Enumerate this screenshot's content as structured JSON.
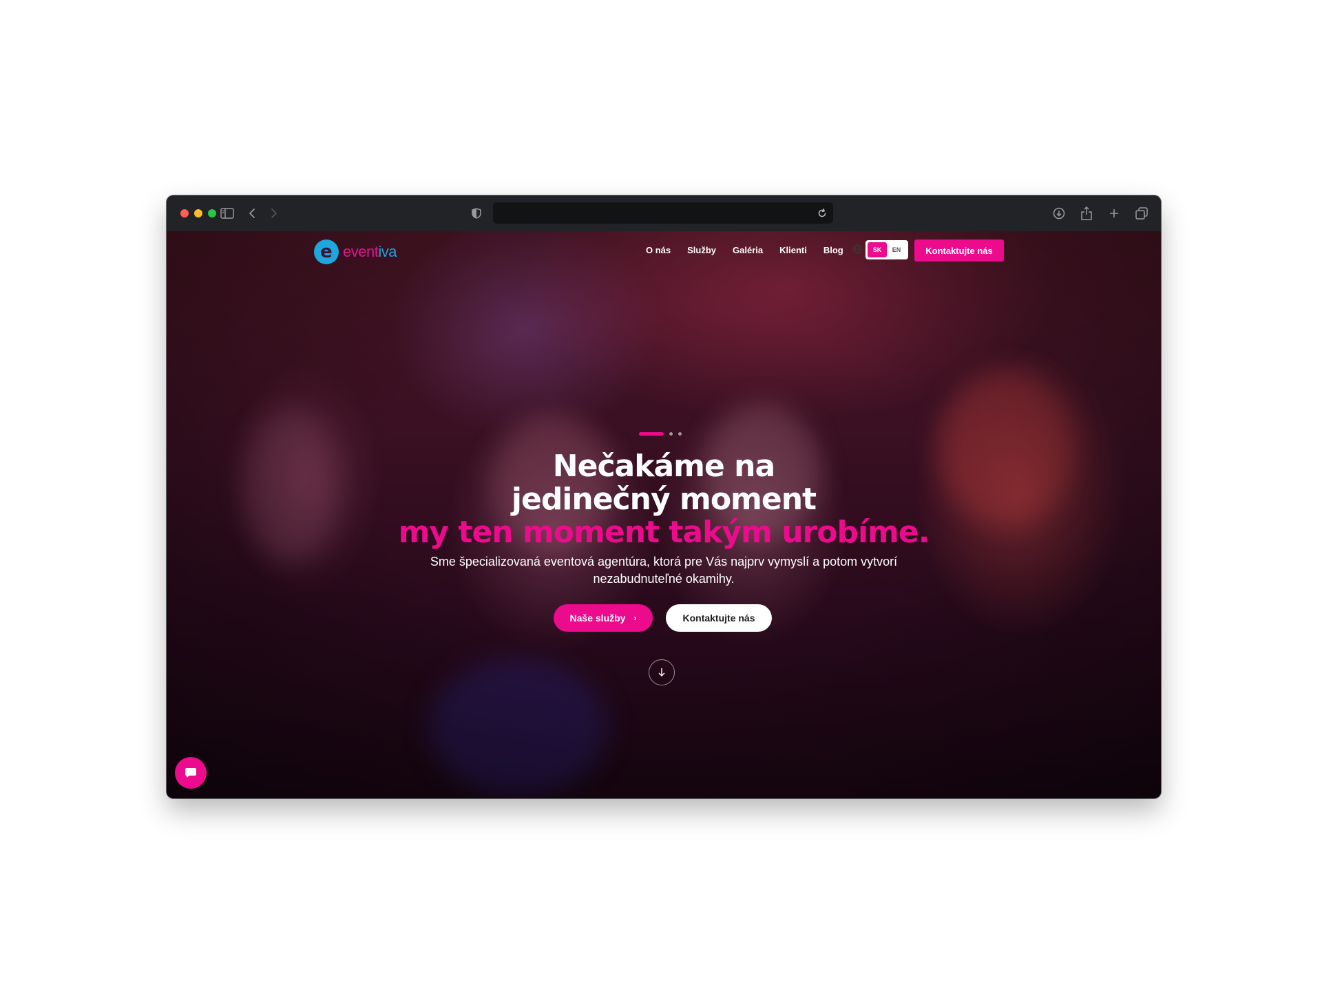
{
  "browser": {
    "address_text": "",
    "icons": {
      "sidebar": "sidebar-icon",
      "back": "chevron-left-icon",
      "forward": "chevron-right-icon",
      "shield": "shield-icon",
      "reload": "reload-icon",
      "download": "download-icon",
      "share": "share-icon",
      "new_tab": "plus-icon",
      "tabs": "tabs-overview-icon"
    }
  },
  "header": {
    "logo_part1": "event",
    "logo_part2": "iva",
    "logo_letter": "e",
    "nav": [
      "O nás",
      "Služby",
      "Galéria",
      "Klienti",
      "Blog"
    ],
    "lang_active": "SK",
    "lang_inactive": "EN",
    "cta_label": "Kontaktujte nás"
  },
  "hero": {
    "title_line1": "Nečakáme na",
    "title_line2": "jedinečný moment",
    "title_accent": "my ten moment takým urobíme.",
    "subtitle": "Sme špecializovaná eventová agentúra, ktorá pre Vás najprv vymyslí a potom vytvorí nezabudnuteľné okamihy.",
    "primary_button": "Naše služby",
    "secondary_button": "Kontaktujte nás"
  },
  "colors": {
    "accent": "#ec0a8d",
    "logo_blue": "#1ea6dd",
    "toolbar": "#222326"
  }
}
